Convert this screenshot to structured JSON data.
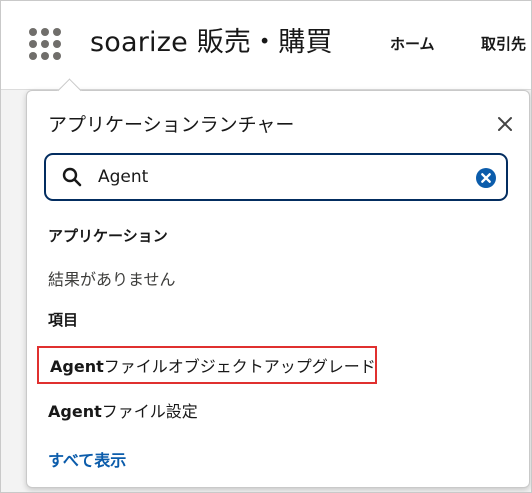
{
  "header": {
    "app_name": "soarize 販売・購買",
    "nav": {
      "home": "ホーム",
      "torihiki": "取引先"
    }
  },
  "launcher": {
    "title": "アプリケーションランチャー",
    "search": {
      "value": "Agent",
      "placeholder": ""
    },
    "apps_section": {
      "label": "アプリケーション",
      "empty": "結果がありません"
    },
    "items_section": {
      "label": "項目",
      "items": [
        {
          "match": "Agent",
          "rest": "ファイルオブジェクトアップグレード"
        },
        {
          "match": "Agent",
          "rest": "ファイル設定"
        }
      ]
    },
    "show_all": "すべて表示"
  },
  "colors": {
    "accent": "#0b5cab",
    "focus_border": "#032d60",
    "highlight_border": "#e0302f"
  },
  "icons": [
    "app-launcher-icon",
    "close-icon",
    "search-icon",
    "clear-icon"
  ]
}
